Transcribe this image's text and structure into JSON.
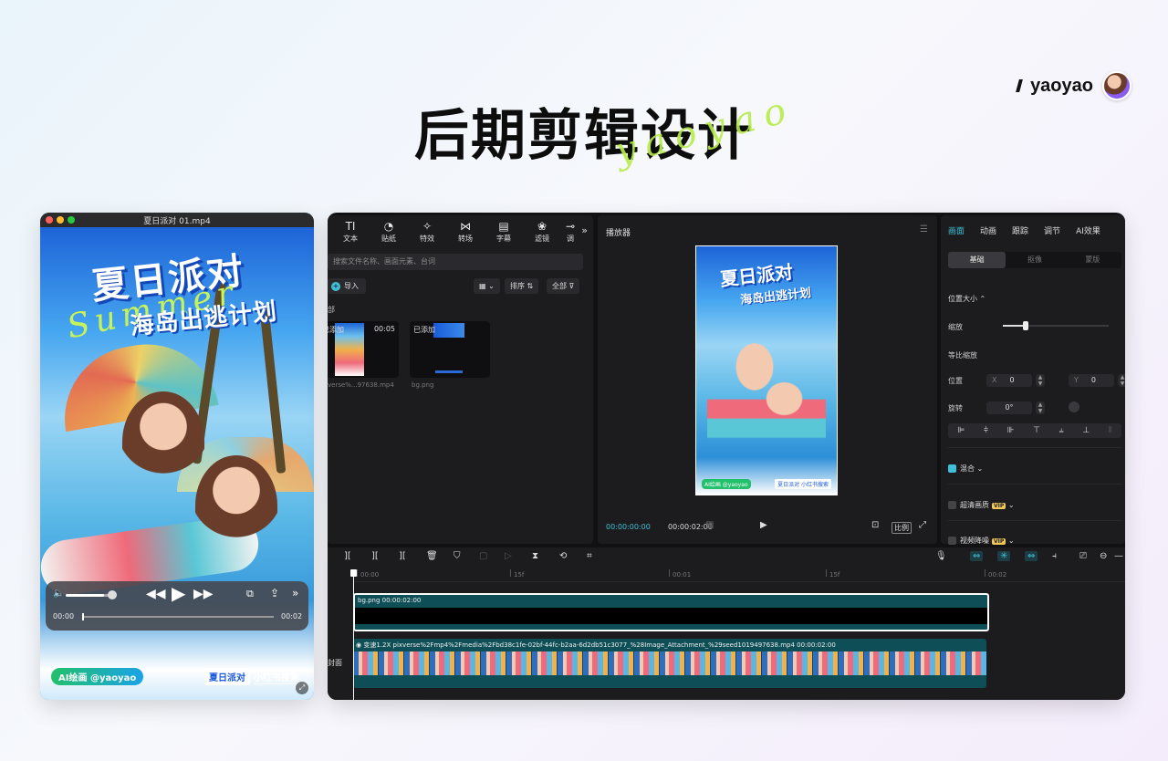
{
  "header": {
    "brand_name": "yaoyao",
    "title": "后期剪辑设计",
    "script_overlay": "yaoyao"
  },
  "quicktime": {
    "file_name": "夏日派对 01.mp4",
    "poster": {
      "title1": "夏日派对",
      "title2": "海岛出逃计划",
      "script": "Summer",
      "tag_left": "AI绘画 @yaoyao",
      "tag_right_a": "夏日派对",
      "tag_right_b": "小红书搜索"
    },
    "controls": {
      "time_current": "00:00",
      "time_total": "00:02",
      "volume_level": 0.8,
      "progress": 0.0
    }
  },
  "editor": {
    "tool_tabs": [
      {
        "icon": "TI",
        "label": "文本"
      },
      {
        "icon": "◔",
        "label": "贴纸"
      },
      {
        "icon": "✧",
        "label": "特效"
      },
      {
        "icon": "⋈",
        "label": "转场"
      },
      {
        "icon": "▤",
        "label": "字幕"
      },
      {
        "icon": "❀",
        "label": "滤镜"
      },
      {
        "icon": "⊸",
        "label": "调"
      }
    ],
    "search_placeholder": "搜索文件名称、画面元素、台词",
    "import_label": "导入",
    "sort_label": "排序",
    "filter_label": "全部",
    "folder_label": "部",
    "media": [
      {
        "status": "已添加",
        "duration": "00:05",
        "name": "verse%...97638.mp4"
      },
      {
        "status": "已添加",
        "duration": "",
        "name": "bg.png"
      }
    ],
    "player": {
      "title": "播放器",
      "time_current": "00:00:00:00",
      "time_total": "00:00:02:00",
      "ratio_label": "比例",
      "frame_title1": "夏日派对",
      "frame_title2": "海岛出逃计划",
      "frame_tag_left": "AI绘画 @yaoyao",
      "frame_tag_right": "夏日派对 小红书搜索"
    },
    "props": {
      "tabs": [
        "画面",
        "动画",
        "跟踪",
        "调节",
        "AI效果"
      ],
      "sub_tabs": [
        "基础",
        "抠像",
        "蒙版"
      ],
      "section_position_size": "位置大小",
      "scale_label": "缩放",
      "scale_value": 0.2,
      "uniform_scale_label": "等比缩放",
      "position_label": "位置",
      "x_axis": "X",
      "x_value": "0",
      "y_axis": "Y",
      "y_value": "0",
      "rotate_label": "旋转",
      "rotate_value": "0°",
      "blend_label": "混合",
      "hd_label": "超清画质",
      "denoise_label": "视频降噪",
      "vip_label": "VIP"
    },
    "timeline": {
      "ruler": [
        "00:00",
        "15f",
        "00:01",
        "15f",
        "00:02"
      ],
      "track_bg_label": "bg.png   00:00:02:00",
      "track_video_speed": "变速1.2X",
      "track_video_label": "pixverse%2Fmp4%2Fmedia%2Fbd38c1fe-02bf-44fc-b2aa-6d2db51c3077_%28Image_Attachment_%29seed1019497638.mp4   00:00:02:00",
      "cover_label": "封面"
    }
  }
}
